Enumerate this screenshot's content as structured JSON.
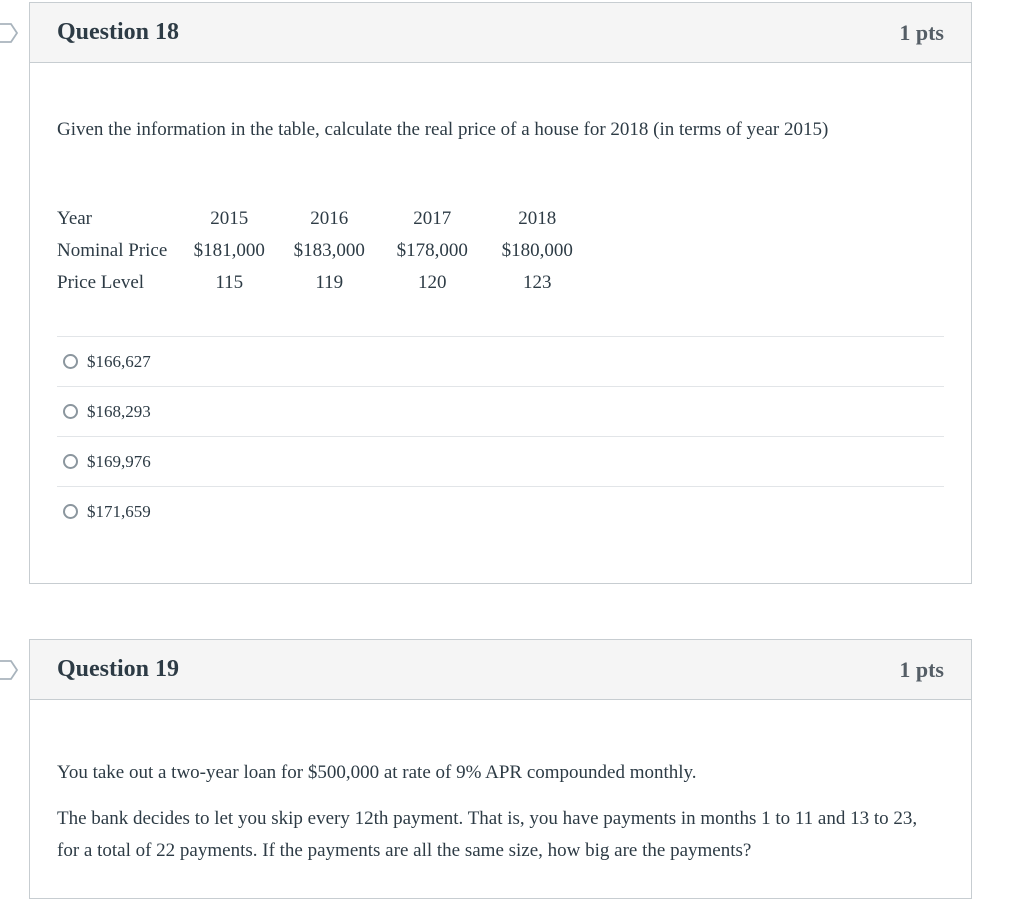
{
  "questions": [
    {
      "title": "Question 18",
      "points": "1 pts",
      "prompt": "Given the information in the table, calculate the real price of a house for 2018 (in terms of year 2015)",
      "table": {
        "rows": [
          {
            "label": "Year",
            "values": [
              "2015",
              "2016",
              "2017",
              "2018"
            ]
          },
          {
            "label": "Nominal Price",
            "values": [
              "$181,000",
              "$183,000",
              "$178,000",
              "$180,000"
            ]
          },
          {
            "label": "Price Level",
            "values": [
              "115",
              "119",
              "120",
              "123"
            ]
          }
        ]
      },
      "answers": [
        {
          "label": "$166,627",
          "selected": false
        },
        {
          "label": "$168,293",
          "selected": false
        },
        {
          "label": "$169,976",
          "selected": false
        },
        {
          "label": "$171,659",
          "selected": false
        }
      ]
    },
    {
      "title": "Question 19",
      "points": "1 pts",
      "paragraphs": [
        "You take out a two-year loan for $500,000 at rate of 9% APR compounded monthly.",
        "The bank decides to let you skip every 12th payment. That is, you have payments in months 1 to 11 and 13 to 23, for a total of 22 payments. If the payments are all the same size, how big are the payments?"
      ]
    }
  ],
  "icons": {
    "flag": "question-flag-icon",
    "radio": "radio-button-icon"
  }
}
